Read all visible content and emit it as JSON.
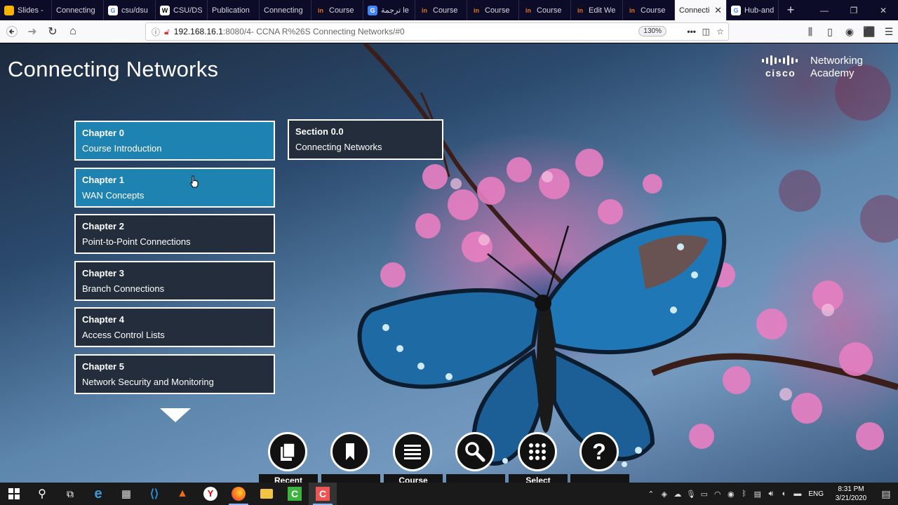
{
  "browser": {
    "tabs": [
      {
        "label": "Slides -",
        "icon": "google-slides-icon",
        "color": "#f4b400"
      },
      {
        "label": "Connecting",
        "icon": "page-icon",
        "color": "#555"
      },
      {
        "label": "csu/dsu",
        "icon": "google-icon",
        "color": "#4285f4"
      },
      {
        "label": "CSU/DS",
        "icon": "wikipedia-icon",
        "color": "#ffffff"
      },
      {
        "label": "Publication",
        "icon": "page-icon",
        "color": "#555"
      },
      {
        "label": "Connecting",
        "icon": "page-icon",
        "color": "#555"
      },
      {
        "label": "Course",
        "icon": "netacad-icon",
        "color": "#e8731d"
      },
      {
        "label": "ترجمة le",
        "icon": "google-translate-icon",
        "color": "#4285f4"
      },
      {
        "label": "Course",
        "icon": "netacad-icon",
        "color": "#e8731d"
      },
      {
        "label": "Course",
        "icon": "netacad-icon",
        "color": "#e8731d"
      },
      {
        "label": "Course",
        "icon": "netacad-icon",
        "color": "#e8731d"
      },
      {
        "label": "Edit We",
        "icon": "netacad-icon",
        "color": "#e8731d"
      },
      {
        "label": "Course",
        "icon": "netacad-icon",
        "color": "#e8731d"
      },
      {
        "label": "Connecti",
        "icon": "page-icon",
        "color": "#555",
        "active": true
      },
      {
        "label": "Hub-and",
        "icon": "google-icon",
        "color": "#4285f4"
      }
    ],
    "url_host": "192.168.16.1",
    "url_path": ":8080/4- CCNA R%26S Connecting Networks/#0",
    "zoom": "130%"
  },
  "page": {
    "title": "Connecting Networks",
    "logo_word": "cisco",
    "logo_line1": "Networking",
    "logo_line2": "Academy"
  },
  "chapters": [
    {
      "number": "Chapter 0",
      "name": "Course Introduction",
      "selected": true
    },
    {
      "number": "Chapter 1",
      "name": "WAN Concepts",
      "selected": true
    },
    {
      "number": "Chapter 2",
      "name": "Point-to-Point Connections",
      "selected": false
    },
    {
      "number": "Chapter 3",
      "name": "Branch Connections",
      "selected": false
    },
    {
      "number": "Chapter 4",
      "name": "Access Control Lists",
      "selected": false
    },
    {
      "number": "Chapter 5",
      "name": "Network Security and Monitoring",
      "selected": false
    }
  ],
  "section": {
    "number": "Section 0.0",
    "name": "Connecting Networks"
  },
  "bottom_nav": [
    {
      "label": "Recent",
      "icon": "recent-pages-icon"
    },
    {
      "label": "",
      "icon": "bookmark-icon"
    },
    {
      "label": "Course",
      "icon": "menu-lines-icon"
    },
    {
      "label": "",
      "icon": "search-icon"
    },
    {
      "label": "Select",
      "icon": "grid-dots-icon"
    },
    {
      "label": "",
      "icon": "help-icon"
    }
  ],
  "taskbar": {
    "language": "ENG",
    "time": "8:31 PM",
    "date": "3/21/2020"
  },
  "colors": {
    "selected_chapter": "#1f83b2",
    "chapter_bg": "#232d3b",
    "browser_tabbar": "#0c0c28"
  }
}
